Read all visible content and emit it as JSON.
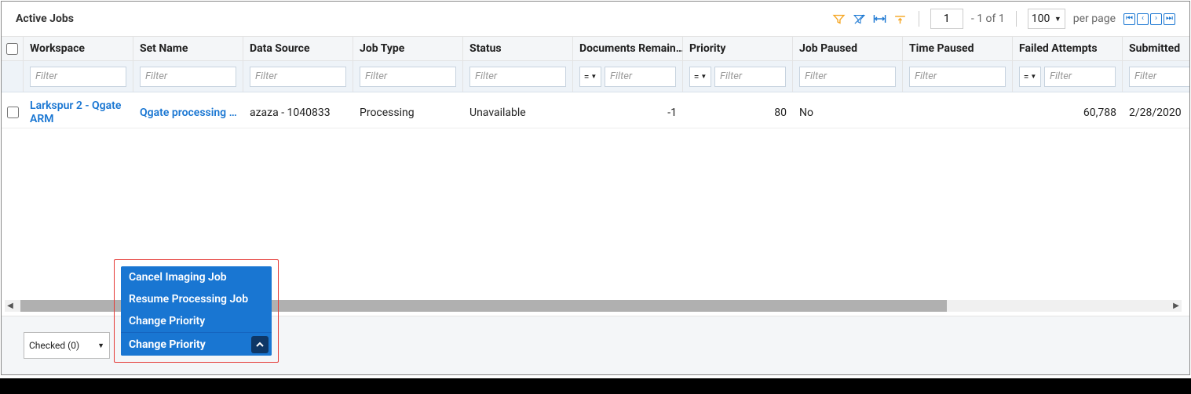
{
  "title": "Active Jobs",
  "toolbar": {
    "page_current": "1",
    "page_range": "- 1 of 1",
    "per_page": "100",
    "per_label": "per page"
  },
  "columns": {
    "workspace": "Workspace",
    "set": "Set Name",
    "source": "Data Source",
    "jobtype": "Job Type",
    "status": "Status",
    "docs": "Documents Remain…",
    "priority": "Priority",
    "paused": "Job Paused",
    "time": "Time Paused",
    "fail": "Failed Attempts",
    "submitted": "Submitted"
  },
  "filters": {
    "placeholder": "Filter",
    "op_eq": "="
  },
  "row": {
    "workspace": "Larkspur 2 - Qgate ARM",
    "set": "Qgate processing s…",
    "source": "azaza - 1040833",
    "jobtype": "Processing",
    "status": "Unavailable",
    "docs": "-1",
    "priority": "80",
    "paused": "No",
    "time": "",
    "fail": "60,788",
    "submitted": "2/28/2020"
  },
  "footer": {
    "checked_label": "Checked (0)"
  },
  "menu": {
    "items": [
      "Cancel Imaging Job",
      "Resume Processing Job",
      "Change Priority"
    ],
    "button": "Change Priority"
  }
}
